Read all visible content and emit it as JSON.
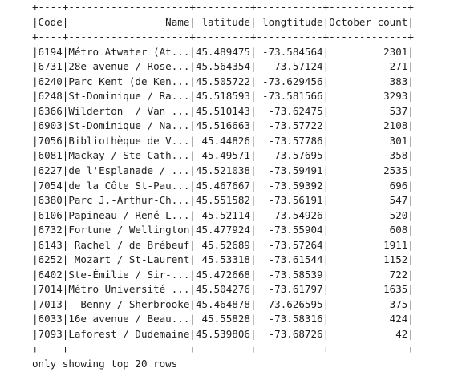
{
  "table": {
    "border": "+----+--------------------+---------+-----------+-------------+",
    "header": "|Code|                Name| latitude| longtitude|October count|",
    "rows": [
      "|6194|Métro Atwater (At...|45.489475| -73.584564|         2301|",
      "|6731|28e avenue / Rose...|45.564354|  -73.57124|          271|",
      "|6240|Parc Kent (de Ken...|45.505722| -73.629456|          383|",
      "|6248|St-Dominique / Ra...|45.518593| -73.581566|         3293|",
      "|6366|Wilderton  / Van ...|45.510143|  -73.62475|          537|",
      "|6903|St-Dominique / Na...|45.516663|  -73.57722|         2108|",
      "|7056|Bibliothèque de V...| 45.44826|  -73.57786|          301|",
      "|6081|Mackay / Ste-Cath...| 45.49571|  -73.57695|          358|",
      "|6227|de l'Esplanade / ...|45.521038|  -73.59491|         2535|",
      "|7054|de la Côte St-Pau...|45.467667|  -73.59392|          696|",
      "|6380|Parc J.-Arthur-Ch...|45.551582|  -73.56191|          547|",
      "|6106|Papineau / René-L...| 45.52114|  -73.54926|          520|",
      "|6732|Fortune / Wellington|45.477924|  -73.55904|          608|",
      "|6143| Rachel / de Brébeuf| 45.52689|  -73.57264|         1911|",
      "|6252| Mozart / St-Laurent| 45.53318|  -73.61544|         1152|",
      "|6402|Ste-Émilie / Sir-...|45.472668|  -73.58539|          722|",
      "|7014|Métro Université ...|45.504276|  -73.61797|         1635|",
      "|7013|  Benny / Sherbrooke|45.464878| -73.626595|          375|",
      "|6033|16e avenue / Beau...| 45.55828|  -73.58316|          424|",
      "|7093|Laforest / Dudemaine|45.539806|  -73.68726|           42|"
    ]
  },
  "footer": "only showing top 20 rows"
}
